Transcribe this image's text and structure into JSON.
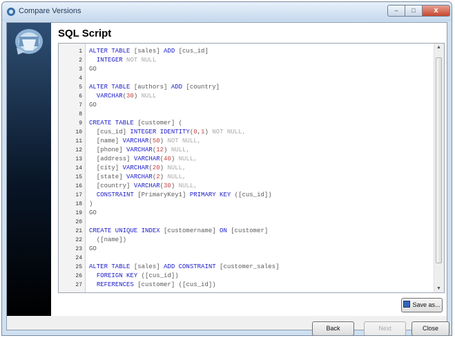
{
  "window": {
    "title": "Compare Versions",
    "minimize_glyph": "–",
    "maximize_glyph": "□",
    "close_glyph": "x"
  },
  "page": {
    "heading": "SQL Script"
  },
  "icons": {
    "app": "app-icon",
    "logo": "database-logo-icon",
    "save": "floppy-disk-icon"
  },
  "colors": {
    "keyword": "#2020cc",
    "identifier": "#5a5a5a",
    "null_keyword": "#a9a9a9",
    "number": "#c84040",
    "sidebar": "#0b1b30"
  },
  "script": {
    "lines": [
      {
        "n": "1",
        "t": [
          {
            "c": "kw",
            "v": "ALTER TABLE"
          },
          {
            "c": "plain",
            "v": " [sales] "
          },
          {
            "c": "kw",
            "v": "ADD"
          },
          {
            "c": "plain",
            "v": " [cus_id]"
          }
        ]
      },
      {
        "n": "2",
        "t": [
          {
            "c": "plain",
            "v": "  "
          },
          {
            "c": "kw",
            "v": "INTEGER"
          },
          {
            "c": "mut",
            "v": " NOT NULL"
          }
        ]
      },
      {
        "n": "3",
        "t": [
          {
            "c": "plain",
            "v": "GO"
          }
        ]
      },
      {
        "n": "4",
        "t": []
      },
      {
        "n": "5",
        "t": [
          {
            "c": "kw",
            "v": "ALTER TABLE"
          },
          {
            "c": "plain",
            "v": " [authors] "
          },
          {
            "c": "kw",
            "v": "ADD"
          },
          {
            "c": "plain",
            "v": " [country]"
          }
        ]
      },
      {
        "n": "6",
        "t": [
          {
            "c": "plain",
            "v": "  "
          },
          {
            "c": "kw",
            "v": "VARCHAR"
          },
          {
            "c": "plain",
            "v": "("
          },
          {
            "c": "num",
            "v": "30"
          },
          {
            "c": "plain",
            "v": ")"
          },
          {
            "c": "mut",
            "v": " NULL"
          }
        ]
      },
      {
        "n": "7",
        "t": [
          {
            "c": "plain",
            "v": "GO"
          }
        ]
      },
      {
        "n": "8",
        "t": []
      },
      {
        "n": "9",
        "t": [
          {
            "c": "kw",
            "v": "CREATE TABLE"
          },
          {
            "c": "plain",
            "v": " [customer] ("
          }
        ]
      },
      {
        "n": "10",
        "t": [
          {
            "c": "plain",
            "v": "  [cus_id] "
          },
          {
            "c": "kw",
            "v": "INTEGER IDENTITY"
          },
          {
            "c": "plain",
            "v": "("
          },
          {
            "c": "num",
            "v": "0"
          },
          {
            "c": "plain",
            "v": ","
          },
          {
            "c": "num",
            "v": "1"
          },
          {
            "c": "plain",
            "v": ")"
          },
          {
            "c": "mut",
            "v": " NOT NULL,"
          }
        ]
      },
      {
        "n": "11",
        "t": [
          {
            "c": "plain",
            "v": "  [name] "
          },
          {
            "c": "kw",
            "v": "VARCHAR"
          },
          {
            "c": "plain",
            "v": "("
          },
          {
            "c": "num",
            "v": "50"
          },
          {
            "c": "plain",
            "v": ")"
          },
          {
            "c": "mut",
            "v": " NOT NULL,"
          }
        ]
      },
      {
        "n": "12",
        "t": [
          {
            "c": "plain",
            "v": "  [phone] "
          },
          {
            "c": "kw",
            "v": "VARCHAR"
          },
          {
            "c": "plain",
            "v": "("
          },
          {
            "c": "num",
            "v": "12"
          },
          {
            "c": "plain",
            "v": ")"
          },
          {
            "c": "mut",
            "v": " NULL,"
          }
        ]
      },
      {
        "n": "13",
        "t": [
          {
            "c": "plain",
            "v": "  [address] "
          },
          {
            "c": "kw",
            "v": "VARCHAR"
          },
          {
            "c": "plain",
            "v": "("
          },
          {
            "c": "num",
            "v": "40"
          },
          {
            "c": "plain",
            "v": ")"
          },
          {
            "c": "mut",
            "v": " NULL,"
          }
        ]
      },
      {
        "n": "14",
        "t": [
          {
            "c": "plain",
            "v": "  [city] "
          },
          {
            "c": "kw",
            "v": "VARCHAR"
          },
          {
            "c": "plain",
            "v": "("
          },
          {
            "c": "num",
            "v": "20"
          },
          {
            "c": "plain",
            "v": ")"
          },
          {
            "c": "mut",
            "v": " NULL,"
          }
        ]
      },
      {
        "n": "15",
        "t": [
          {
            "c": "plain",
            "v": "  [state] "
          },
          {
            "c": "kw",
            "v": "VARCHAR"
          },
          {
            "c": "plain",
            "v": "("
          },
          {
            "c": "num",
            "v": "2"
          },
          {
            "c": "plain",
            "v": ")"
          },
          {
            "c": "mut",
            "v": " NULL,"
          }
        ]
      },
      {
        "n": "16",
        "t": [
          {
            "c": "plain",
            "v": "  [country] "
          },
          {
            "c": "kw",
            "v": "VARCHAR"
          },
          {
            "c": "plain",
            "v": "("
          },
          {
            "c": "num",
            "v": "30"
          },
          {
            "c": "plain",
            "v": ")"
          },
          {
            "c": "mut",
            "v": " NULL,"
          }
        ]
      },
      {
        "n": "17",
        "t": [
          {
            "c": "plain",
            "v": "  "
          },
          {
            "c": "kw",
            "v": "CONSTRAINT"
          },
          {
            "c": "plain",
            "v": " [PrimaryKey1] "
          },
          {
            "c": "kw",
            "v": "PRIMARY KEY"
          },
          {
            "c": "plain",
            "v": " ([cus_id])"
          }
        ]
      },
      {
        "n": "18",
        "t": [
          {
            "c": "plain",
            "v": ")"
          }
        ]
      },
      {
        "n": "19",
        "t": [
          {
            "c": "plain",
            "v": "GO"
          }
        ]
      },
      {
        "n": "20",
        "t": []
      },
      {
        "n": "21",
        "t": [
          {
            "c": "kw",
            "v": "CREATE UNIQUE INDEX"
          },
          {
            "c": "plain",
            "v": " [customername] "
          },
          {
            "c": "kw",
            "v": "ON"
          },
          {
            "c": "plain",
            "v": " [customer]"
          }
        ]
      },
      {
        "n": "22",
        "t": [
          {
            "c": "plain",
            "v": "  ([name])"
          }
        ]
      },
      {
        "n": "23",
        "t": [
          {
            "c": "plain",
            "v": "GO"
          }
        ]
      },
      {
        "n": "24",
        "t": []
      },
      {
        "n": "25",
        "t": [
          {
            "c": "kw",
            "v": "ALTER TABLE"
          },
          {
            "c": "plain",
            "v": " [sales] "
          },
          {
            "c": "kw",
            "v": "ADD CONSTRAINT"
          },
          {
            "c": "plain",
            "v": " [customer_sales]"
          }
        ]
      },
      {
        "n": "26",
        "t": [
          {
            "c": "plain",
            "v": "  "
          },
          {
            "c": "kw",
            "v": "FOREIGN KEY"
          },
          {
            "c": "plain",
            "v": " ([cus_id])"
          }
        ]
      },
      {
        "n": "27",
        "t": [
          {
            "c": "plain",
            "v": "  "
          },
          {
            "c": "kw",
            "v": "REFERENCES"
          },
          {
            "c": "plain",
            "v": " [customer] ([cus_id])"
          }
        ]
      }
    ]
  },
  "buttons": {
    "save": "Save as...",
    "back": "Back",
    "next": "Next",
    "close": "Close"
  }
}
